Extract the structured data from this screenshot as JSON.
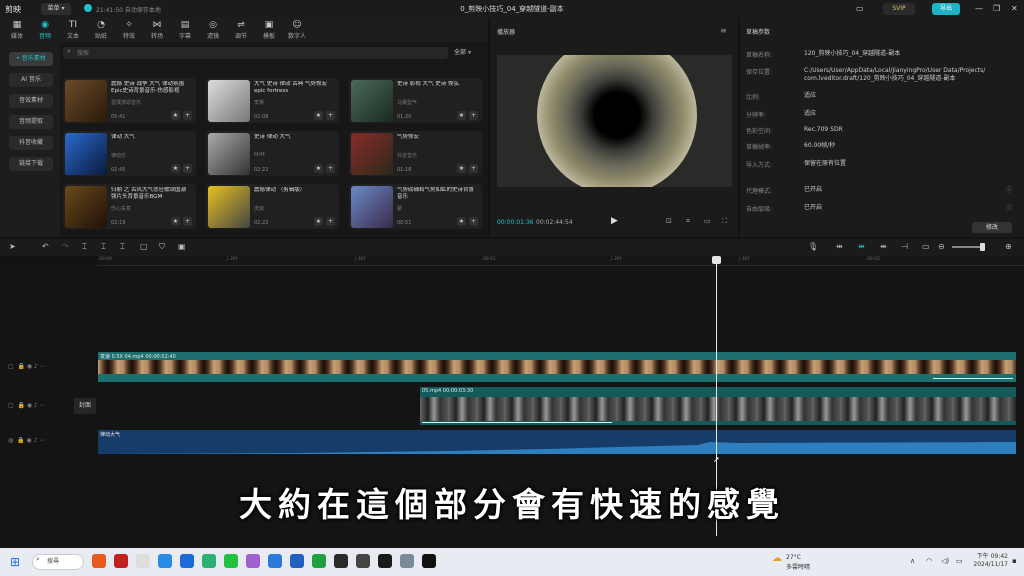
{
  "titlebar": {
    "logo": "剪映",
    "menu": "菜单 ▾",
    "save": "21:41:50 自动保存本地",
    "title": "0_剪映小技巧_04_穿越隧道-副本",
    "svip": "SVIP",
    "export": "导出",
    "controls": [
      "▭",
      "—",
      "❐",
      "✕"
    ]
  },
  "tabs": [
    {
      "icon": "▦",
      "label": "媒体"
    },
    {
      "icon": "◉",
      "label": "音频"
    },
    {
      "icon": "TI",
      "label": "文本"
    },
    {
      "icon": "◔",
      "label": "贴纸"
    },
    {
      "icon": "✧",
      "label": "特效"
    },
    {
      "icon": "⋈",
      "label": "转场"
    },
    {
      "icon": "▤",
      "label": "字幕"
    },
    {
      "icon": "◎",
      "label": "滤镜"
    },
    {
      "icon": "⇌",
      "label": "调节"
    },
    {
      "icon": "▣",
      "label": "模板"
    },
    {
      "icon": "☺",
      "label": "数字人"
    }
  ],
  "leftnav": [
    "• 音乐素材",
    "AI 音乐",
    "音效素材",
    "音频提取",
    "抖音收藏",
    "链接下载"
  ],
  "search": {
    "placeholder": "搜索",
    "filter": "全部 ⩔"
  },
  "cards": [
    {
      "title": "震撼 史诗 战争 大气 律动氛围 Epic史诗背景音乐-伤感影视",
      "sub": "墨璞漫颂音乐",
      "dur": "05:41",
      "g": "#6a4a2a,#2a1a0a"
    },
    {
      "title": "大气 史诗 律动 古典 气势恢宏 epic fortress",
      "sub": "李爽",
      "dur": "02:08",
      "g": "#ddd,#777"
    },
    {
      "title": "史诗 影视 大气 史诗 恢弘",
      "sub": "马赛型气",
      "dur": "01:20",
      "g": "#4a6a5a,#1a2a20"
    },
    {
      "title": "律动 大气",
      "sub": "律动乐",
      "dur": "02:45",
      "g": "#2a6acf,#0a1a3a"
    },
    {
      "title": "史诗 律动 大气",
      "sub": "MrM",
      "dur": "02:22",
      "g": "#aaa,#333"
    },
    {
      "title": "气势恢宏",
      "sub": "抖音音乐",
      "dur": "01:18",
      "g": "#8a2a2a,#2a2a1a"
    },
    {
      "title": "归期 之 古风大气悲壮歌颂国潮 强片头背景音乐BGM",
      "sub": "伤心失意",
      "dur": "02:19",
      "g": "#6a4a1a,#201008"
    },
    {
      "title": "震撼律动 （剪辑版）",
      "sub": "流浪",
      "dur": "02:22",
      "g": "#e8c020,#444"
    },
    {
      "title": "气势磅礴和气势如虹的史诗背景 音乐",
      "sub": "蒙",
      "dur": "00:51",
      "g": "#6a8ac8,#3a2a4a"
    }
  ],
  "player": {
    "title": "播放器",
    "current": "00:00:01:36",
    "duration": "00:02:44:54",
    "play": "▶"
  },
  "props": {
    "title": "草稿参数",
    "rows": [
      {
        "k": "草稿名称:",
        "v": "120_剪映小技巧_04_穿越隧道-副本"
      },
      {
        "k": "保存位置:",
        "v": "C:/Users/User/AppData/Local/JianyingPro/User Data/Projects/ com.lveditor.draft/120_剪映小技巧_04_穿越隧道-副本"
      },
      {
        "k": "比例:",
        "v": "适应"
      },
      {
        "k": "分辨率:",
        "v": "适应"
      },
      {
        "k": "色彩空间:",
        "v": "Rec.709 SDR"
      },
      {
        "k": "草稿帧率:",
        "v": "60.00帧/秒"
      },
      {
        "k": "导入方式:",
        "v": "保留在原有位置"
      },
      {
        "k": "代理模式:",
        "v": "已开启"
      },
      {
        "k": "自由层级:",
        "v": "已开启"
      }
    ],
    "modify": "修改"
  },
  "ruler": [
    "00:00",
    "| 20f",
    "| 40f",
    "00:01",
    "| 20f",
    "| 40f",
    "00:02"
  ],
  "tracks": {
    "cover": "封面",
    "clip1": "变速 0.5X  04.mp4  00:00:02:40",
    "clip2": "05.mp4  00:00:03:30",
    "audio": "律动大气"
  },
  "subtitle": "大約在這個部分會有快速的感覺",
  "taskbar": {
    "search": "搜尋",
    "weather_temp": "27°C",
    "weather_desc": "多雲時晴",
    "time": "下午 09:42",
    "date": "2024/11/17"
  }
}
